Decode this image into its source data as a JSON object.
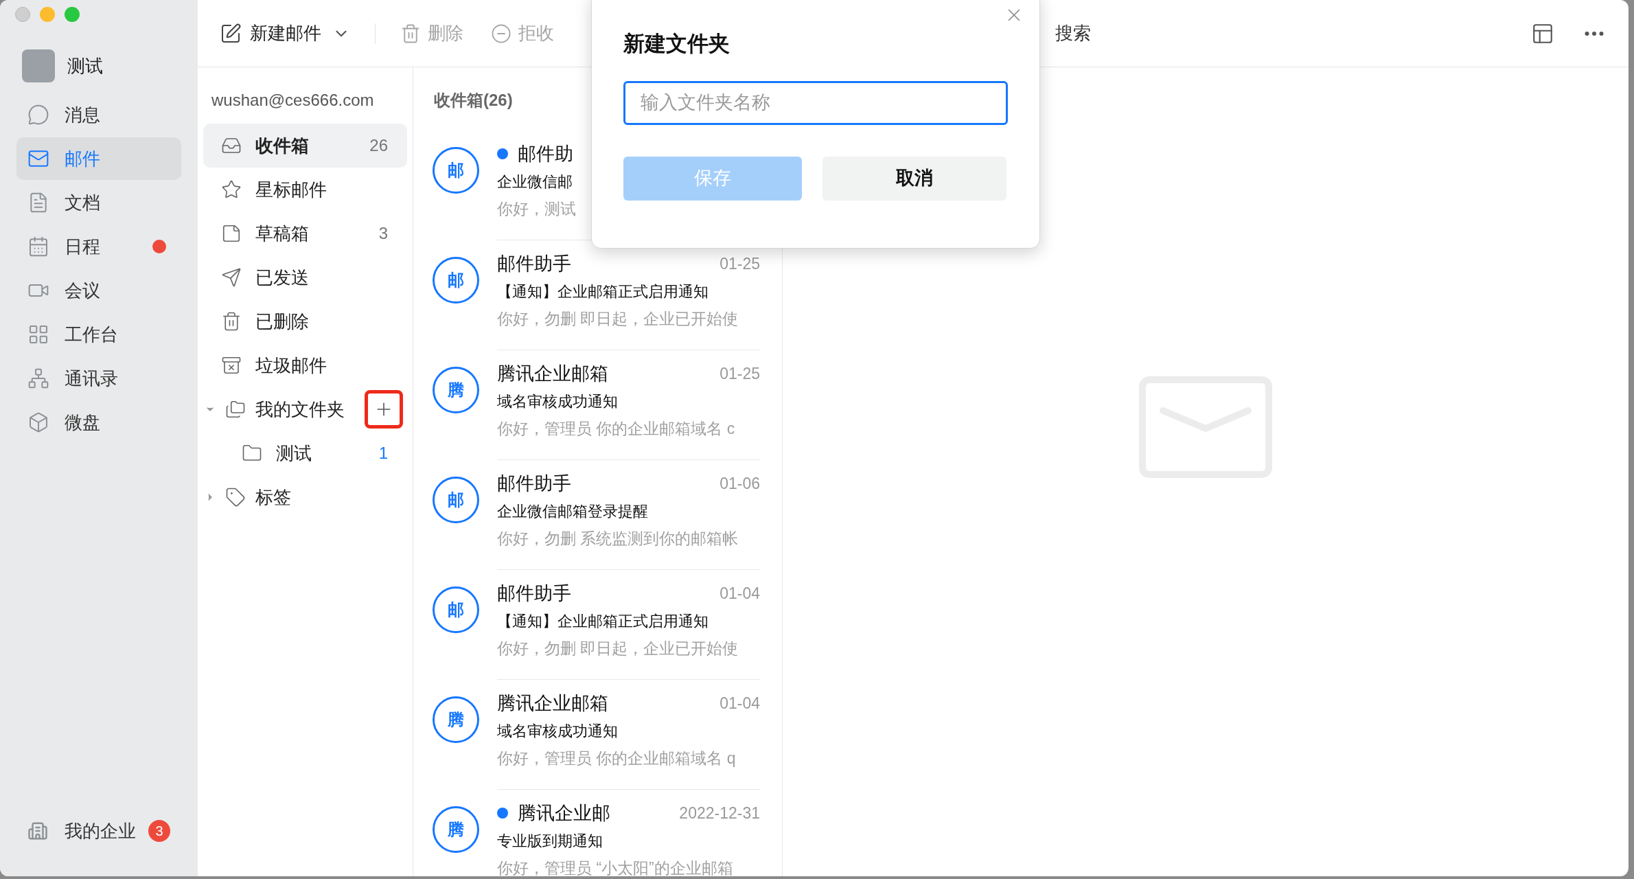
{
  "sidebar": {
    "profile": {
      "name": "测试"
    },
    "items": [
      {
        "kind": "message",
        "label": "消息",
        "selected": false,
        "dot": false
      },
      {
        "kind": "mail",
        "label": "邮件",
        "selected": true,
        "dot": false
      },
      {
        "kind": "docs",
        "label": "文档",
        "selected": false,
        "dot": false
      },
      {
        "kind": "calendar",
        "label": "日程",
        "selected": false,
        "dot": true
      },
      {
        "kind": "meeting",
        "label": "会议",
        "selected": false,
        "dot": false
      },
      {
        "kind": "workbench",
        "label": "工作台",
        "selected": false,
        "dot": false
      },
      {
        "kind": "contacts",
        "label": "通讯录",
        "selected": false,
        "dot": false
      },
      {
        "kind": "drive",
        "label": "微盘",
        "selected": false,
        "dot": false
      }
    ],
    "footer": {
      "label": "我的企业",
      "badge": "3"
    }
  },
  "toolbar": {
    "new_mail": "新建邮件",
    "actions": [
      {
        "kind": "delete",
        "label": "删除"
      },
      {
        "kind": "reject",
        "label": "拒收"
      }
    ],
    "search": "搜索"
  },
  "account": "wushan@ces666.com",
  "folders": [
    {
      "kind": "inbox",
      "label": "收件箱",
      "count": "26",
      "selected": true
    },
    {
      "kind": "starred",
      "label": "星标邮件",
      "selected": false
    },
    {
      "kind": "drafts",
      "label": "草稿箱",
      "count": "3",
      "selected": false
    },
    {
      "kind": "sent",
      "label": "已发送",
      "selected": false
    },
    {
      "kind": "deleted",
      "label": "已删除",
      "selected": false
    },
    {
      "kind": "spam",
      "label": "垃圾邮件",
      "selected": false
    }
  ],
  "my_folders": {
    "label": "我的文件夹",
    "expanded": true,
    "add_highlighted": true,
    "children": [
      {
        "label": "测试",
        "count": "1",
        "selected": false
      }
    ]
  },
  "tags": {
    "label": "标签",
    "expanded": false
  },
  "mail_list": {
    "title": "收件箱(26)",
    "items": [
      {
        "avatar": "邮",
        "unread": true,
        "sender": "邮件助",
        "subject": "企业微信邮",
        "preview": "你好，测试"
      },
      {
        "avatar": "邮",
        "unread": false,
        "sender": "邮件助手",
        "date": "01-25",
        "subject": "【通知】企业邮箱正式启用通知",
        "preview": "你好，勿删 即日起，企业已开始使"
      },
      {
        "avatar": "腾",
        "unread": false,
        "sender": "腾讯企业邮箱",
        "date": "01-25",
        "subject": "域名审核成功通知",
        "preview": "你好，管理员 你的企业邮箱域名 c"
      },
      {
        "avatar": "邮",
        "unread": false,
        "sender": "邮件助手",
        "date": "01-06",
        "subject": "企业微信邮箱登录提醒",
        "preview": "你好，勿删 系统监测到你的邮箱帐"
      },
      {
        "avatar": "邮",
        "unread": false,
        "sender": "邮件助手",
        "date": "01-04",
        "subject": "【通知】企业邮箱正式启用通知",
        "preview": "你好，勿删 即日起，企业已开始使"
      },
      {
        "avatar": "腾",
        "unread": false,
        "sender": "腾讯企业邮箱",
        "date": "01-04",
        "subject": "域名审核成功通知",
        "preview": "你好，管理员 你的企业邮箱域名 q"
      },
      {
        "avatar": "腾",
        "unread": true,
        "sender": "腾讯企业邮",
        "date": "2022-12-31",
        "subject": "专业版到期通知",
        "preview": "你好，管理员 “小太阳”的企业邮箱"
      }
    ]
  },
  "dialog": {
    "title": "新建文件夹",
    "placeholder": "输入文件夹名称",
    "save": "保存",
    "save_disabled": true,
    "cancel": "取消"
  }
}
